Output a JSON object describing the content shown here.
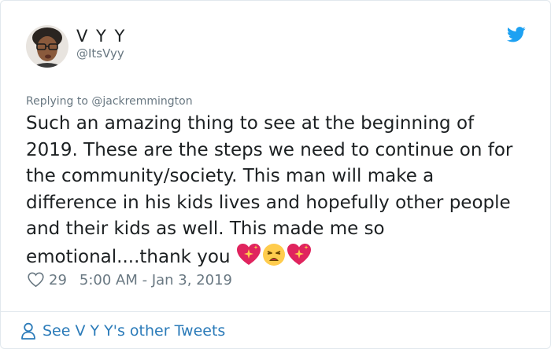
{
  "author": {
    "display_name": "V Y Y",
    "handle": "@ItsVyy"
  },
  "tweet": {
    "reply_line": "Replying to @jackremmington",
    "text": "Such an amazing thing to see at the beginning of 2019. These are the steps we need to continue on for the community/society. This man will make a difference in his kids lives and hopefully other people and their kids as well. This made me so emotional....thank you",
    "emojis": [
      "sparkling-heart",
      "weary-face",
      "sparkling-heart"
    ],
    "likes": "29",
    "timestamp": "5:00 AM - Jan 3, 2019"
  },
  "footer": {
    "other_tweets_label": "See V Y Y's other Tweets"
  },
  "colors": {
    "twitter_blue": "#1da1f2",
    "link_blue": "#2b7bb9",
    "muted": "#697882",
    "text": "#1c2022"
  }
}
